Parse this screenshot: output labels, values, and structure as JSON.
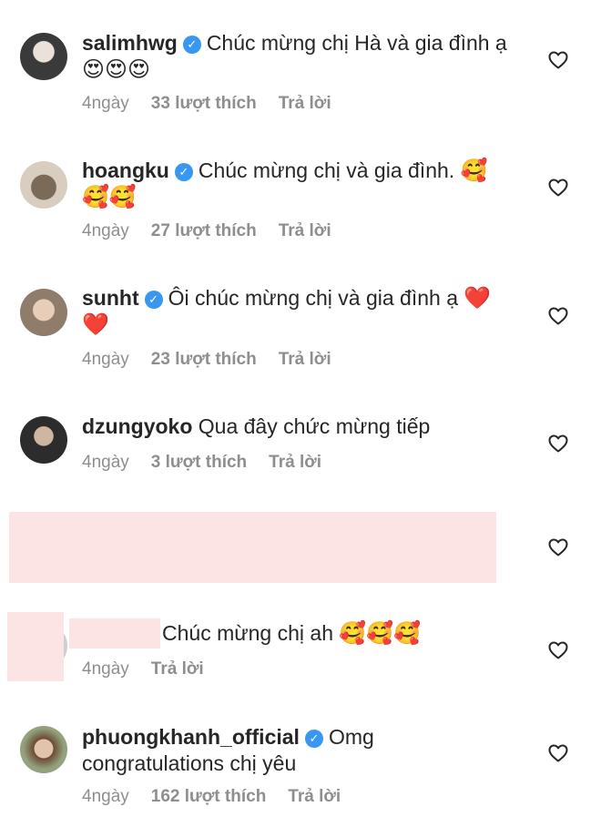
{
  "comments": [
    {
      "username": "salimhwg",
      "text": "Chúc mừng chị Hà và gia đình ạ",
      "emoji": "😍😍😍",
      "age": "4ngày",
      "likes": "33 lượt thích",
      "reply": "Trả lời",
      "avatar_color": "#3a3a3a"
    },
    {
      "username": "hoangku",
      "text": "Chúc mừng chị và gia đình.",
      "emoji": "🥰🥰🥰",
      "age": "4ngày",
      "likes": "27 lượt thích",
      "reply": "Trả lời",
      "avatar_color": "#b9a98f"
    },
    {
      "username": "sunht",
      "text": "Ôi chúc mừng chị và gia đình ạ",
      "emoji": "❤️❤️",
      "age": "4ngày",
      "likes": "23 lượt thích",
      "reply": "Trả lời",
      "avatar_color": "#c9a890"
    },
    {
      "username": "dzungyoko",
      "text": "Qua đây chức mừng tiếp",
      "age": "4ngày",
      "likes": "3 lượt thích",
      "reply": "Trả lời",
      "avatar_color": "#2c2c2c"
    },
    {
      "text": "Chúc mừng chị ah",
      "emoji": "🥰🥰🥰",
      "age": "4ngày",
      "reply": "Trả lời"
    },
    {
      "username": "phuongkhanh_official",
      "text": "Omg congratulations chị yêu",
      "age": "4ngày",
      "likes": "162 lượt thích",
      "reply": "Trả lời",
      "avatar_color": "#6b4a35"
    }
  ],
  "colors": {
    "verified": "#3897f0",
    "meta_text": "#8e8e8e",
    "redaction": "#fde4e4"
  },
  "icons": {
    "like": "heart-outline-icon",
    "verified": "verified-badge-icon"
  }
}
